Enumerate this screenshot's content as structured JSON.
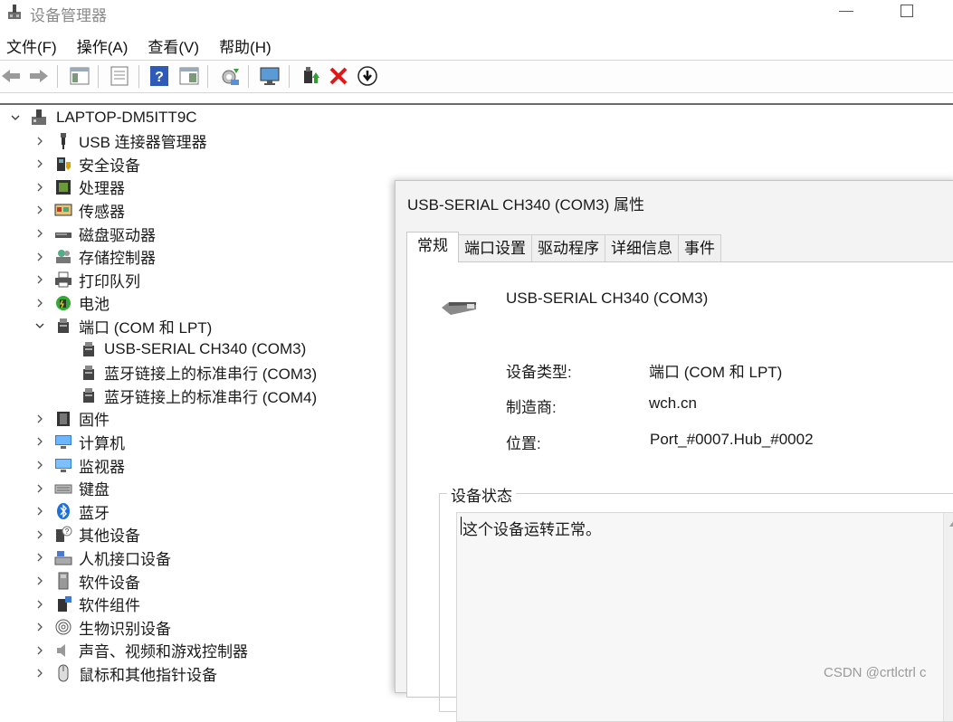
{
  "window": {
    "title": "设备管理器"
  },
  "menu": [
    "文件(F)",
    "操作(A)",
    "查看(V)",
    "帮助(H)"
  ],
  "toolbar": [
    "back-icon",
    "forward-icon",
    "properties-view-icon",
    "list-icon",
    "help-icon",
    "action-view-icon",
    "scan-hardware-icon",
    "monitor-icon",
    "update-driver-icon",
    "uninstall-icon",
    "disable-icon"
  ],
  "tree": {
    "root": "LAPTOP-DM5ITT9C",
    "items": [
      {
        "label": "USB 连接器管理器",
        "icon": "usb-icon",
        "expanded": false
      },
      {
        "label": "安全设备",
        "icon": "security-device-icon",
        "expanded": false
      },
      {
        "label": "处理器",
        "icon": "processor-icon",
        "expanded": false
      },
      {
        "label": "传感器",
        "icon": "sensor-icon",
        "expanded": false
      },
      {
        "label": "磁盘驱动器",
        "icon": "disk-icon",
        "expanded": false
      },
      {
        "label": "存储控制器",
        "icon": "storage-controller-icon",
        "expanded": false
      },
      {
        "label": "打印队列",
        "icon": "printer-icon",
        "expanded": false
      },
      {
        "label": "电池",
        "icon": "battery-icon",
        "expanded": false
      },
      {
        "label": "端口 (COM 和 LPT)",
        "icon": "port-icon",
        "expanded": true,
        "children": [
          "USB-SERIAL CH340 (COM3)",
          "蓝牙链接上的标准串行 (COM3)",
          "蓝牙链接上的标准串行 (COM4)"
        ]
      },
      {
        "label": "固件",
        "icon": "firmware-icon",
        "expanded": false
      },
      {
        "label": "计算机",
        "icon": "computer-icon",
        "expanded": false
      },
      {
        "label": "监视器",
        "icon": "monitor-icon",
        "expanded": false
      },
      {
        "label": "键盘",
        "icon": "keyboard-icon",
        "expanded": false
      },
      {
        "label": "蓝牙",
        "icon": "bluetooth-icon",
        "expanded": false
      },
      {
        "label": "其他设备",
        "icon": "other-device-icon",
        "expanded": false
      },
      {
        "label": "人机接口设备",
        "icon": "hid-icon",
        "expanded": false
      },
      {
        "label": "软件设备",
        "icon": "software-device-icon",
        "expanded": false
      },
      {
        "label": "软件组件",
        "icon": "software-component-icon",
        "expanded": false
      },
      {
        "label": "生物识别设备",
        "icon": "fingerprint-icon",
        "expanded": false
      },
      {
        "label": "声音、视频和游戏控制器",
        "icon": "speaker-icon",
        "expanded": false
      },
      {
        "label": "鼠标和其他指针设备",
        "icon": "mouse-icon",
        "expanded": false
      }
    ]
  },
  "dialog": {
    "title": "USB-SERIAL CH340 (COM3) 属性",
    "tabs": [
      "常规",
      "端口设置",
      "驱动程序",
      "详细信息",
      "事件"
    ],
    "active_tab": "常规",
    "device_name": "USB-SERIAL CH340 (COM3)",
    "props": [
      {
        "label": "设备类型:",
        "value": "端口 (COM 和 LPT)"
      },
      {
        "label": "制造商:",
        "value": "wch.cn"
      },
      {
        "label": "位置:",
        "value": "Port_#0007.Hub_#0002"
      }
    ],
    "status_group_label": "设备状态",
    "status_text": "这个设备运转正常。"
  },
  "watermark": "CSDN @crtlctrl c"
}
